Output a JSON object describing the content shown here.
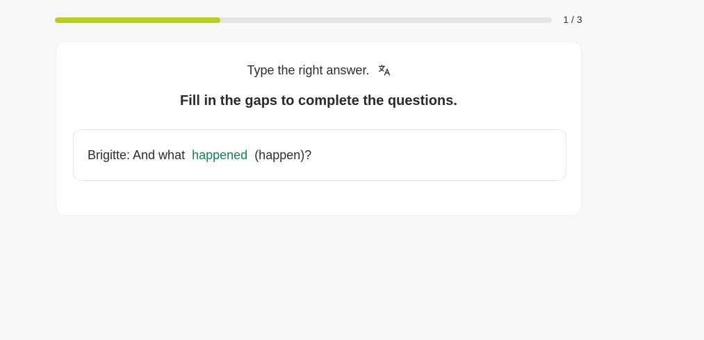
{
  "progress": {
    "fraction": 0.333,
    "count_label": "1 / 3",
    "fill_color": "#b9cf1b"
  },
  "exercise": {
    "instruction": "Type the right answer.",
    "translate_icon": "translate-icon",
    "title": "Fill in the gaps to complete the questions.",
    "question": {
      "prefix": "Brigitte: And what",
      "answer": "happened",
      "suffix": "(happen)?"
    },
    "answer_color": "#12805c"
  }
}
